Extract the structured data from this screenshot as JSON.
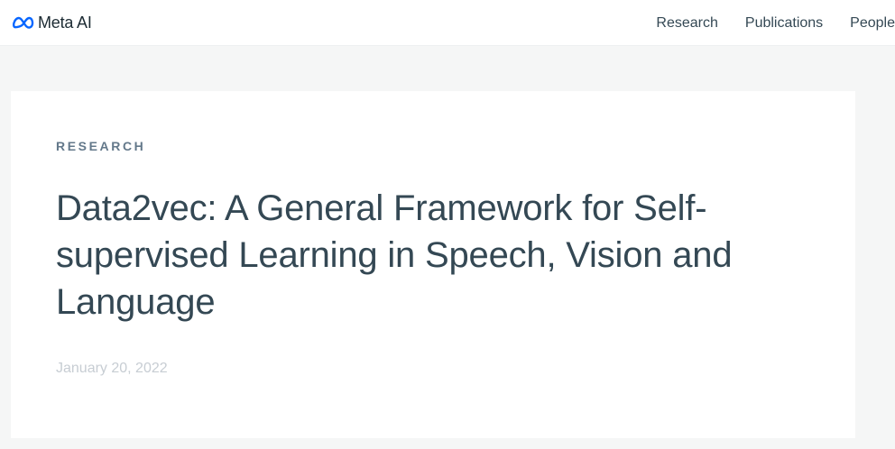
{
  "header": {
    "brand": "Meta AI",
    "logo_icon": "meta-infinity-icon",
    "brand_color": "#0866ff",
    "nav": [
      {
        "label": "Research"
      },
      {
        "label": "Publications"
      },
      {
        "label": "People"
      }
    ]
  },
  "article": {
    "category": "RESEARCH",
    "title": "Data2vec: A General Framework for Self-supervised Learning in Speech, Vision and Language",
    "date": "January 20, 2022"
  },
  "colors": {
    "background": "#f5f6f6",
    "text": "#344854",
    "category": "#63788a",
    "date": "#c7cdd3"
  }
}
